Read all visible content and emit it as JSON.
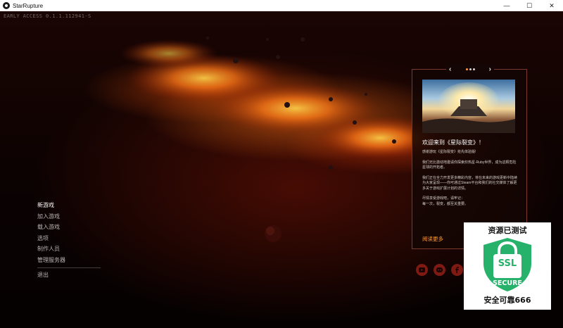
{
  "window": {
    "title": "StarRupture",
    "minimize_glyph": "—",
    "maximize_glyph": "☐",
    "close_glyph": "✕"
  },
  "game": {
    "version": "EARLY ACCESS 0.1.1.112941-S"
  },
  "menu": {
    "items": [
      {
        "label": "新游戏",
        "active": true
      },
      {
        "label": "加入游戏"
      },
      {
        "label": "载入游戏"
      },
      {
        "label": "选项"
      },
      {
        "label": "制作人员"
      },
      {
        "label": "管理服务器"
      },
      {
        "label": "退出"
      }
    ]
  },
  "news": {
    "prev_glyph": "‹",
    "next_glyph": "›",
    "title": "欢迎来到《星际裂变》！",
    "paragraphs": [
      "感谢游玩《星际裂变》抢先体验版!",
      "我们无比激动地邀请你探索炽热星-Ruby世界，成为这颗危险星球的开拓者。",
      "我们正在全力开发更多精彩内容，将在未来的游戏更新中陆续为大家呈现——你可通过Steam平台和我们的社交媒体了解更多关于游戏扩展计划的详情。",
      "尽情享受游戏吧，请牢记：\n每一次，裂变，都至关重要。"
    ],
    "read_more": "阅读更多"
  },
  "social": [
    {
      "icon": "youtube-icon"
    },
    {
      "icon": "discord-icon"
    },
    {
      "icon": "facebook-icon"
    }
  ],
  "badge": {
    "title": "资源已测试",
    "shield_line1": "SSL",
    "shield_line2": "SECURE",
    "footer": "安全可靠666"
  },
  "colors": {
    "accent": "#ff9a3a",
    "badge_green": "#27b26b",
    "panel_border": "#7b3a2c"
  }
}
